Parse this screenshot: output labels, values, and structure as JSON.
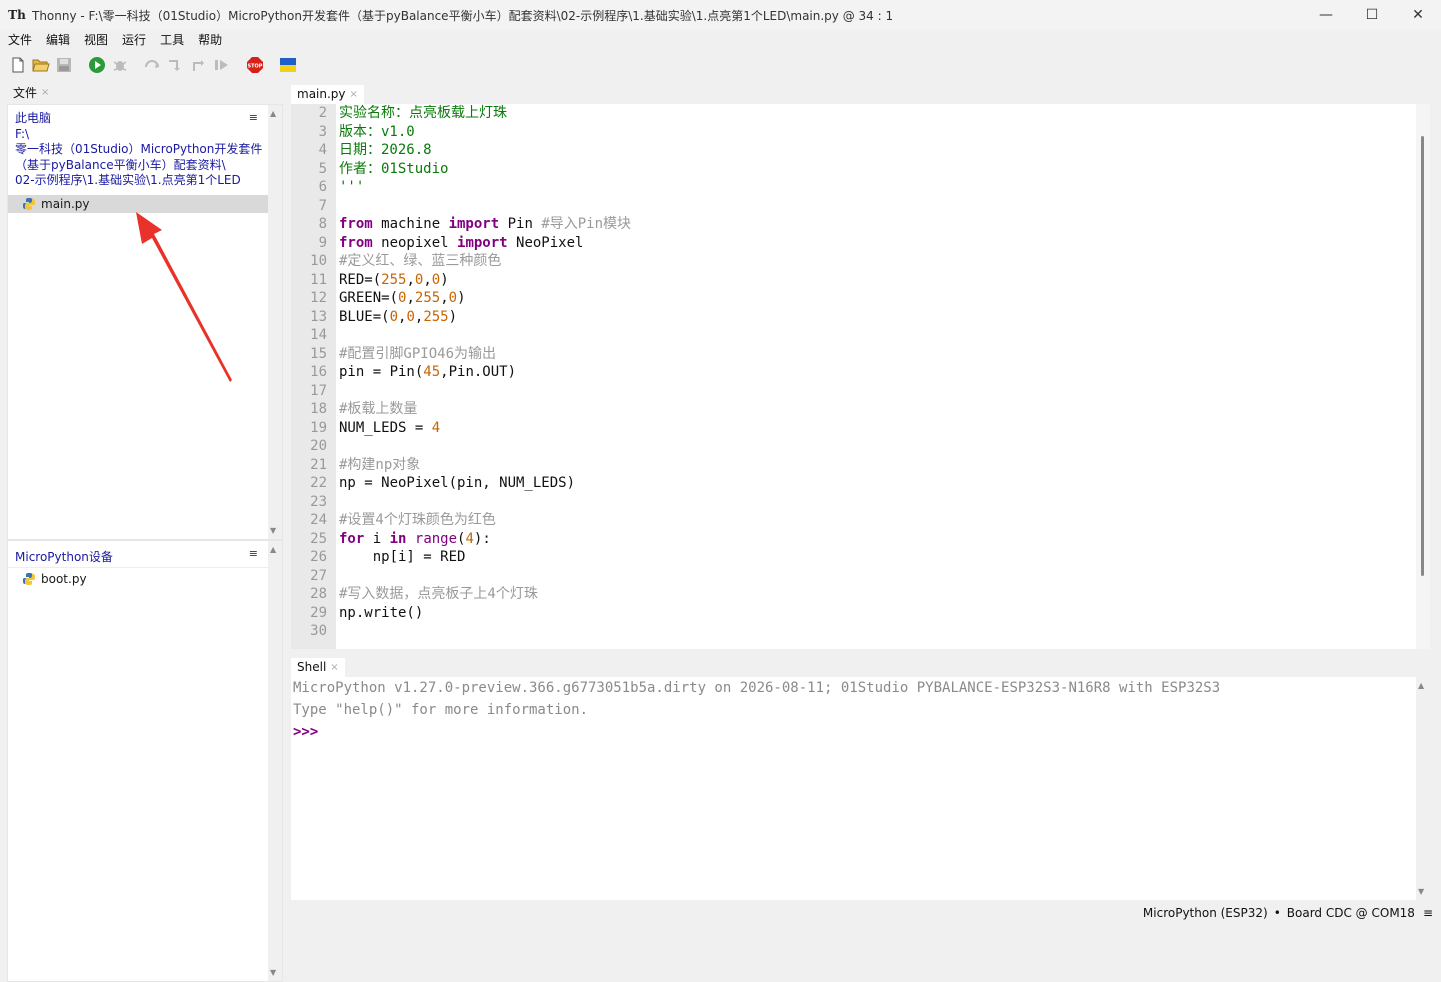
{
  "window": {
    "title": "Thonny  -  F:\\零一科技（01Studio）MicroPython开发套件（基于pyBalance平衡小车）配套资料\\02-示例程序\\1.基础实验\\1.点亮第1个LED\\main.py  @  34 : 1",
    "app_icon": "Th"
  },
  "menu": [
    "文件",
    "编辑",
    "视图",
    "运行",
    "工具",
    "帮助"
  ],
  "toolbar_icons": [
    "new-file-icon",
    "open-file-icon",
    "save-icon",
    "run-icon",
    "debug-icon",
    "step-over-icon",
    "step-into-icon",
    "step-out-icon",
    "resume-icon",
    "stop-icon",
    "ukraine-flag-icon"
  ],
  "files_panel": {
    "tab_label": "文件",
    "close": "×",
    "menu_glyph": "≡",
    "path_lines": [
      "此电脑",
      "F:\\",
      "零一科技（01Studio）MicroPython开发套件",
      "（基于pyBalance平衡小车）配套资料\\",
      "02-示例程序\\1.基础实验\\1.点亮第1个LED"
    ],
    "files": [
      {
        "name": "main.py",
        "selected": true
      }
    ]
  },
  "device_panel": {
    "title": "MicroPython设备",
    "menu_glyph": "≡",
    "files": [
      {
        "name": "boot.py"
      }
    ]
  },
  "editor": {
    "tab_label": "main.py",
    "close": "×",
    "line_numbers": [
      "2",
      "3",
      "4",
      "5",
      "6",
      "7",
      "8",
      "9",
      "10",
      "11",
      "12",
      "13",
      "14",
      "15",
      "16",
      "17",
      "18",
      "19",
      "20",
      "21",
      "22",
      "23",
      "24",
      "25",
      "26",
      "27",
      "28",
      "29",
      "30"
    ]
  },
  "shell": {
    "tab_label": "Shell",
    "close": "×",
    "lines": [
      "MicroPython v1.27.0-preview.366.g6773051b5a.dirty on 2026-08-11; 01Studio PYBALANCE-ESP32S3-N16R8 with ESP32S3",
      "Type \"help()\" for more information."
    ],
    "prompt": ">>>"
  },
  "status": {
    "interpreter": "MicroPython (ESP32)",
    "separator": "•",
    "port": "Board CDC @ COM18",
    "menu_glyph": "≡"
  },
  "colors": {
    "string": "#0a7a0a",
    "keyword": "#800080",
    "comment": "#9a9a9a",
    "number": "#c86400",
    "annotation_arrow": "#e8322a"
  }
}
